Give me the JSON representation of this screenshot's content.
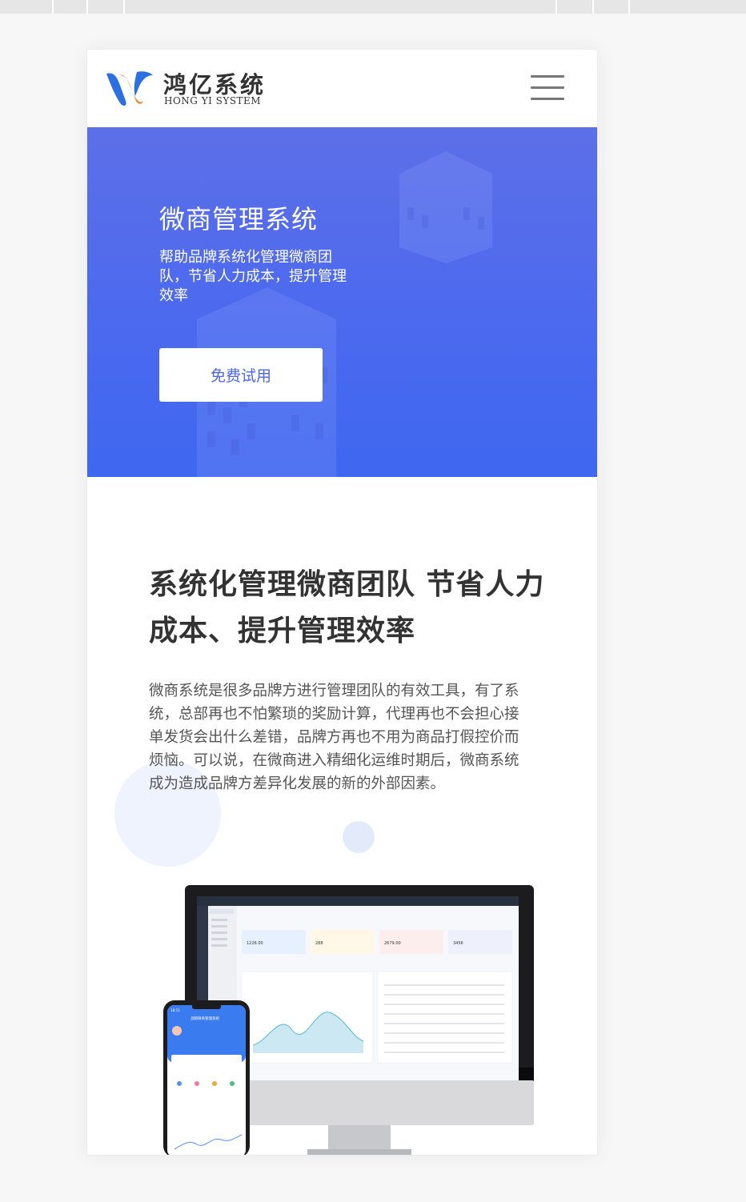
{
  "browser_bar": {},
  "header": {
    "brand_name": "鸿亿系统",
    "brand_subtitle": "HONG YI SYSTEM",
    "menu_icon": "hamburger-menu-icon"
  },
  "hero": {
    "title": "微商管理系统",
    "subtitle": "帮助品牌系统化管理微商团队，节省人力成本，提升管理效率",
    "cta_label": "免费试用"
  },
  "intro": {
    "title": "系统化管理微商团队 节省人力成本、提升管理效率",
    "body": "微商系统是很多品牌方进行管理团队的有效工具，有了系统，总部再也不怕繁琐的奖励计算，代理再也不会担心接单发货会出什么差错，品牌方再也不用为商品打假控价而烦恼。可以说，在微商进入精细化运维时期后，微商系统成为造成品牌方差异化发展的新的外部因素。"
  },
  "mockup": {
    "desktop_stats": [
      "1226.00",
      "288",
      "2679.00",
      "3456"
    ],
    "phone_title": "战狼微商管理系统",
    "phone_time": "18:53"
  },
  "colors": {
    "hero_start": "#5d6fe8",
    "hero_end": "#3f67f0",
    "logo_blue": "#2c6fe0",
    "logo_orange": "#f07a1f",
    "cta_text": "#4a66ee"
  }
}
